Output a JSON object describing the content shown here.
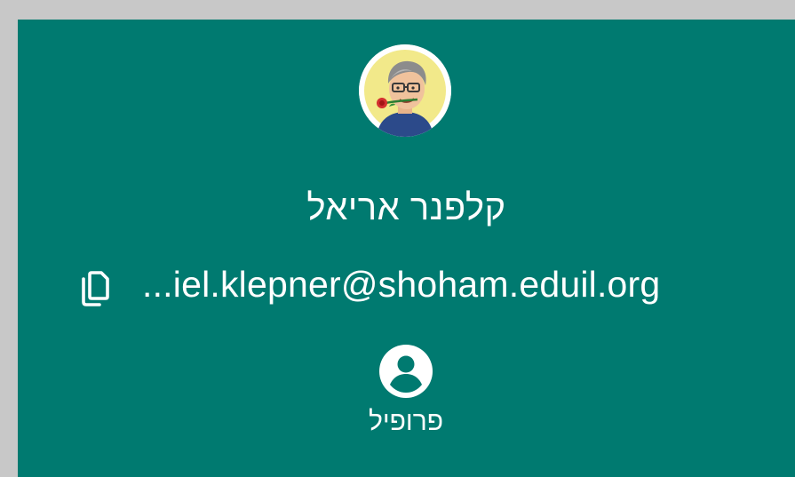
{
  "user": {
    "name": "קלפנר אריאל",
    "email": "...iel.klepner@shoham.eduil.org",
    "avatar_icon": "bitmoji-avatar-icon"
  },
  "actions": {
    "copy_icon": "copy-icon",
    "profile_icon": "account-circle-icon",
    "profile_label": "פרופיל"
  },
  "colors": {
    "background": "#c8c8c8",
    "card": "#007a70",
    "text": "#ffffff"
  }
}
